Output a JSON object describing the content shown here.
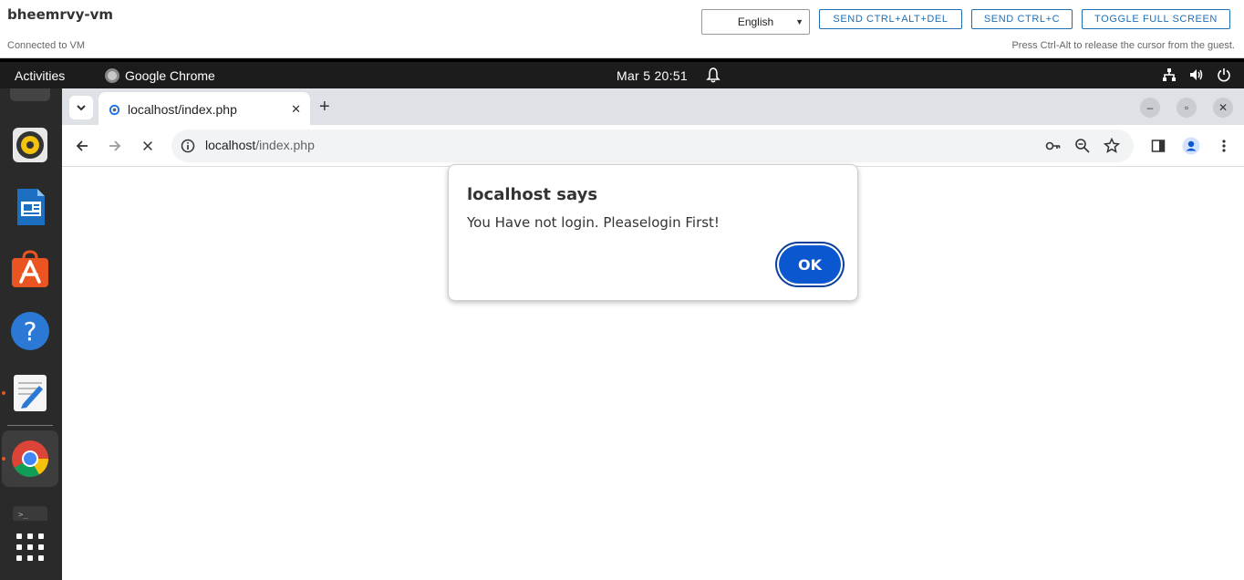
{
  "vm": {
    "title": "bheemrvy-vm",
    "status": "Connected to VM",
    "language": "English",
    "buttons": [
      "SEND CTRL+ALT+DEL",
      "SEND CTRL+C",
      "TOGGLE FULL SCREEN"
    ],
    "hint": "Press Ctrl-Alt to release the cursor from the guest."
  },
  "topbar": {
    "activities": "Activities",
    "app": "Google Chrome",
    "clock": "Mar 5  20:51"
  },
  "dock": {
    "items": [
      "rhythmbox-icon",
      "libreoffice-writer-icon",
      "app-center-icon",
      "help-icon",
      "text-editor-icon",
      "chrome-icon",
      "terminal-icon",
      "show-apps-icon"
    ]
  },
  "browser": {
    "tab_title": "localhost/index.php",
    "url_host": "localhost",
    "url_path": "/index.php"
  },
  "dialog": {
    "title": "localhost says",
    "message": "You Have not login. Pleaselogin First!",
    "ok": "OK"
  },
  "colors": {
    "accent": "#0b57d0",
    "vm_button": "#1f6fb4",
    "dock_bg": "#2a2a2a",
    "topbar_bg": "#1c1c1c"
  }
}
